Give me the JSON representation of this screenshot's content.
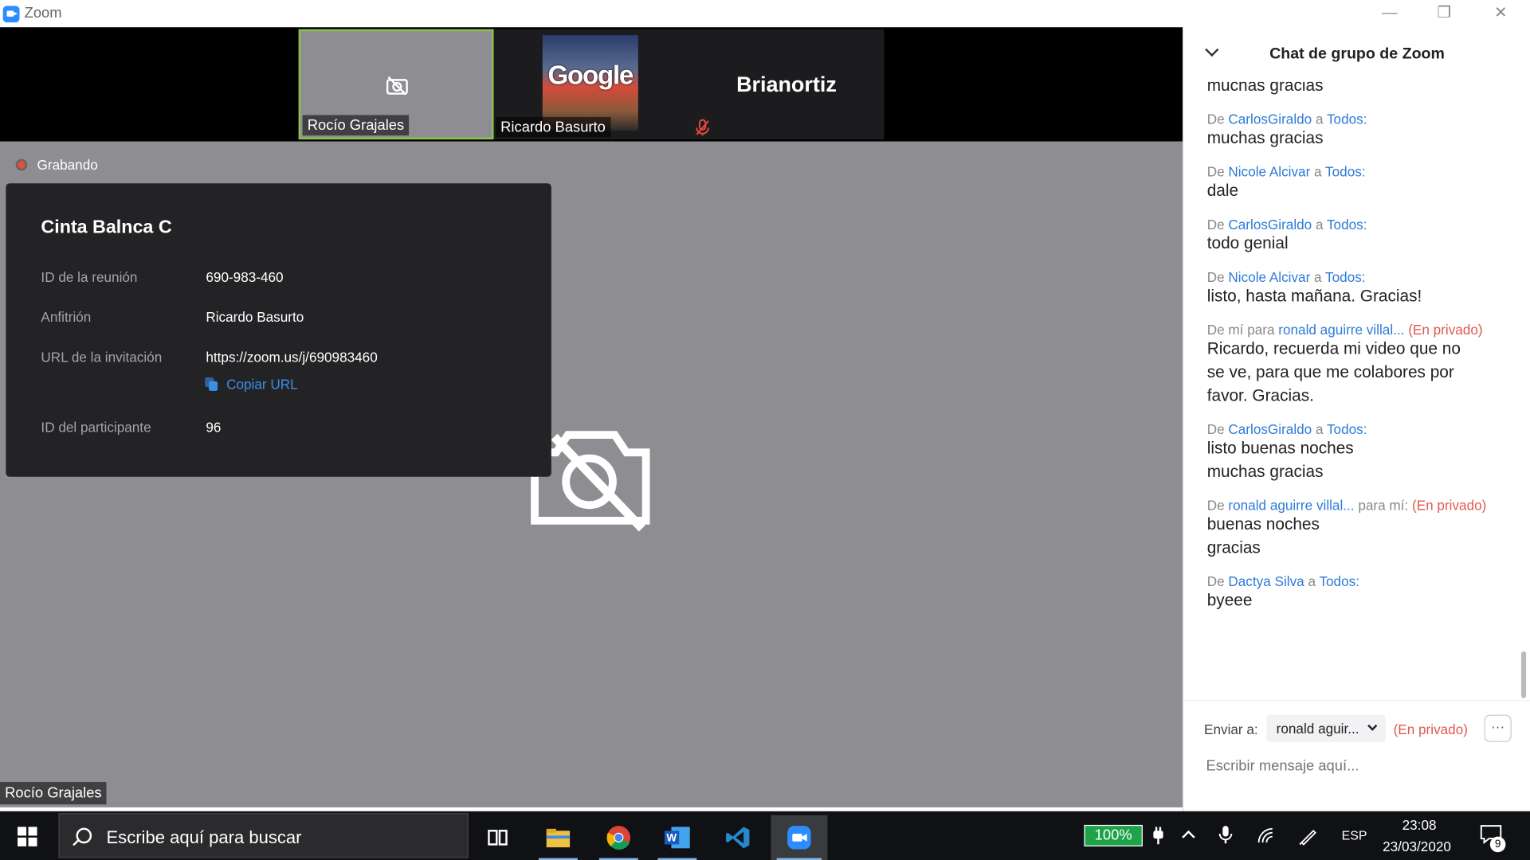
{
  "window": {
    "title": "Zoom",
    "minimize": "—",
    "restore": "❐",
    "close": "✕"
  },
  "participants": [
    {
      "name": "Rocío Grajales"
    },
    {
      "name": "Ricardo Basurto",
      "logo_text": "Google"
    },
    {
      "name": "Brianortiz"
    }
  ],
  "recording": {
    "label": "Grabando"
  },
  "meeting_info": {
    "title": "Cinta Balnca C",
    "id_label": "ID de la reunión",
    "id_value": "690-983-460",
    "host_label": "Anfitrión",
    "host_value": "Ricardo Basurto",
    "url_label": "URL de la invitación",
    "url_value": "https://zoom.us/j/690983460",
    "copy_url": "Copiar URL",
    "participant_id_label": "ID del participante",
    "participant_id_value": "96"
  },
  "active_speaker_label": "Rocío Grajales",
  "chat": {
    "title": "Chat de grupo de Zoom",
    "messages": [
      {
        "lines": [
          "muchas gracias"
        ]
      },
      {
        "from": "CarlosGiraldo",
        "to": "Todos:",
        "lines": [
          "muchas gracias"
        ]
      },
      {
        "from": "Nicole Alcivar",
        "to": "Todos:",
        "lines": [
          "dale"
        ]
      },
      {
        "from": "CarlosGiraldo",
        "to": "Todos:",
        "lines": [
          "todo genial"
        ]
      },
      {
        "from": "Nicole Alcivar",
        "to": "Todos:",
        "lines": [
          "listo, hasta mañana. Gracias!"
        ]
      },
      {
        "from_text": "De mí para",
        "to": "ronald aguirre villal...",
        "private": "(En privado)",
        "lines": [
          "Ricardo, recuerda mi video que no",
          "se ve, para que me colabores por",
          "favor.  Gracias."
        ]
      },
      {
        "from": "CarlosGiraldo",
        "to": "Todos:",
        "lines": [
          "listo buenas noches",
          "muchas gracias"
        ]
      },
      {
        "from": "ronald aguirre villal...",
        "to_text": "para mí:",
        "private": "(En privado)",
        "lines": [
          "buenas noches",
          "gracias"
        ]
      },
      {
        "from": "Dactya Silva",
        "to": "Todos:",
        "lines": [
          "byeee"
        ]
      }
    ],
    "de": "De",
    "a": "a",
    "send_to_label": "Enviar a:",
    "send_to_value": "ronald aguir...",
    "send_to_private": "(En privado)",
    "more": "···",
    "input_placeholder": "Escribir mensaje aquí..."
  },
  "taskbar": {
    "search_text": "Escribe aquí para buscar",
    "battery": "100%",
    "language": "ESP",
    "time": "23:08",
    "date": "23/03/2020",
    "notifications": "9"
  }
}
